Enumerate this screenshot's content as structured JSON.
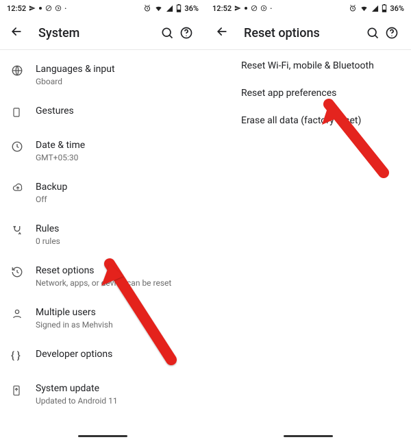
{
  "status": {
    "time": "12:52",
    "battery_text": "36%"
  },
  "pane_left": {
    "title": "System",
    "rows": [
      {
        "icon": "globe-icon",
        "label": "Languages & input",
        "sub": "Gboard"
      },
      {
        "icon": "gesture-icon",
        "label": "Gestures",
        "sub": ""
      },
      {
        "icon": "clock-icon",
        "label": "Date & time",
        "sub": "GMT+05:30"
      },
      {
        "icon": "cloud-icon",
        "label": "Backup",
        "sub": "Off"
      },
      {
        "icon": "rules-icon",
        "label": "Rules",
        "sub": "0 rules"
      },
      {
        "icon": "history-icon",
        "label": "Reset options",
        "sub": "Network, apps, or device can be reset"
      },
      {
        "icon": "person-icon",
        "label": "Multiple users",
        "sub": "Signed in as Mehvish"
      },
      {
        "icon": "braces-icon",
        "label": "Developer options",
        "sub": ""
      },
      {
        "icon": "update-icon",
        "label": "System update",
        "sub": "Updated to Android 11"
      }
    ]
  },
  "pane_right": {
    "title": "Reset options",
    "rows": [
      {
        "label": "Reset Wi-Fi, mobile & Bluetooth"
      },
      {
        "label": "Reset app preferences"
      },
      {
        "label": "Erase all data (factory reset)"
      }
    ]
  }
}
